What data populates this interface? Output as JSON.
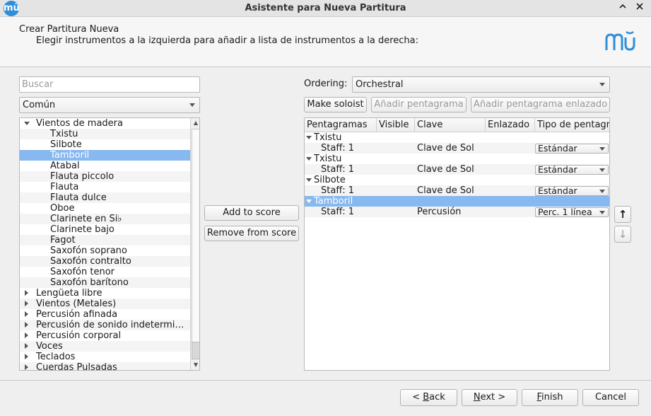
{
  "window": {
    "title": "Asistente para Nueva Partitura",
    "logo_glyph": "mŭ"
  },
  "header": {
    "title": "Crear Partitura Nueva",
    "subtitle": "Elegir instrumentos a la izquierda para añadir a lista de instrumentos a la derecha:",
    "logo_glyph": "mŭ",
    "accent": "#2f8ed8"
  },
  "left": {
    "search_placeholder": "Buscar",
    "category": "Común",
    "tree": [
      {
        "label": "Vientos de madera",
        "level": 0,
        "expanded": true
      },
      {
        "label": "Txistu",
        "level": 1
      },
      {
        "label": "Silbote",
        "level": 1
      },
      {
        "label": "Tamboril",
        "level": 1,
        "selected": true
      },
      {
        "label": "Atabal",
        "level": 1
      },
      {
        "label": "Flauta piccolo",
        "level": 1
      },
      {
        "label": "Flauta",
        "level": 1
      },
      {
        "label": "Flauta dulce",
        "level": 1
      },
      {
        "label": "Oboe",
        "level": 1
      },
      {
        "label": "Clarinete en Si♭",
        "level": 1
      },
      {
        "label": "Clarinete bajo",
        "level": 1
      },
      {
        "label": "Fagot",
        "level": 1
      },
      {
        "label": "Saxofón soprano",
        "level": 1
      },
      {
        "label": "Saxofón contralto",
        "level": 1
      },
      {
        "label": "Saxofón tenor",
        "level": 1
      },
      {
        "label": "Saxofón barítono",
        "level": 1
      },
      {
        "label": "Lengüeta libre",
        "level": 0,
        "expanded": false
      },
      {
        "label": "Vientos (Metales)",
        "level": 0,
        "expanded": false
      },
      {
        "label": "Percusión afinada",
        "level": 0,
        "expanded": false
      },
      {
        "label": "Percusión de sonido indetermi…",
        "level": 0,
        "expanded": false
      },
      {
        "label": "Percusión corporal",
        "level": 0,
        "expanded": false
      },
      {
        "label": "Voces",
        "level": 0,
        "expanded": false
      },
      {
        "label": "Teclados",
        "level": 0,
        "expanded": false
      },
      {
        "label": "Cuerdas Pulsadas",
        "level": 0,
        "expanded": false
      }
    ]
  },
  "middle": {
    "add_label": "Add to score",
    "remove_label": "Remove from score"
  },
  "right": {
    "ordering_label": "Ordering:",
    "ordering_value": "Orchestral",
    "make_soloist": "Make soloist",
    "add_staff": "Añadir pentagrama",
    "add_linked_staff": "Añadir pentagrama enlazado",
    "columns": [
      "Pentagramas",
      "Visible",
      "Clave",
      "Enlazado",
      "Tipo de pentagr"
    ],
    "rows": [
      {
        "type": "instrument",
        "name": "Txistu"
      },
      {
        "type": "staff",
        "name": "Staff: 1",
        "clef": "Clave de Sol",
        "staff_type": "Estándar"
      },
      {
        "type": "instrument",
        "name": "Txistu"
      },
      {
        "type": "staff",
        "name": "Staff: 1",
        "clef": "Clave de Sol",
        "staff_type": "Estándar"
      },
      {
        "type": "instrument",
        "name": "Silbote"
      },
      {
        "type": "staff",
        "name": "Staff: 1",
        "clef": "Clave de Sol",
        "staff_type": "Estándar"
      },
      {
        "type": "instrument",
        "name": "Tamboril",
        "selected": true
      },
      {
        "type": "staff",
        "name": "Staff: 1",
        "clef": "Percusión",
        "staff_type": "Perc. 1 línea"
      }
    ],
    "move_up": "↑",
    "move_down": "↓"
  },
  "footer": {
    "back": {
      "prefix": "< ",
      "mnemonic": "B",
      "rest": "ack"
    },
    "next": {
      "mnemonic": "N",
      "rest": "ext >"
    },
    "finish": {
      "mnemonic": "F",
      "rest": "inish"
    },
    "cancel": "Cancel"
  }
}
